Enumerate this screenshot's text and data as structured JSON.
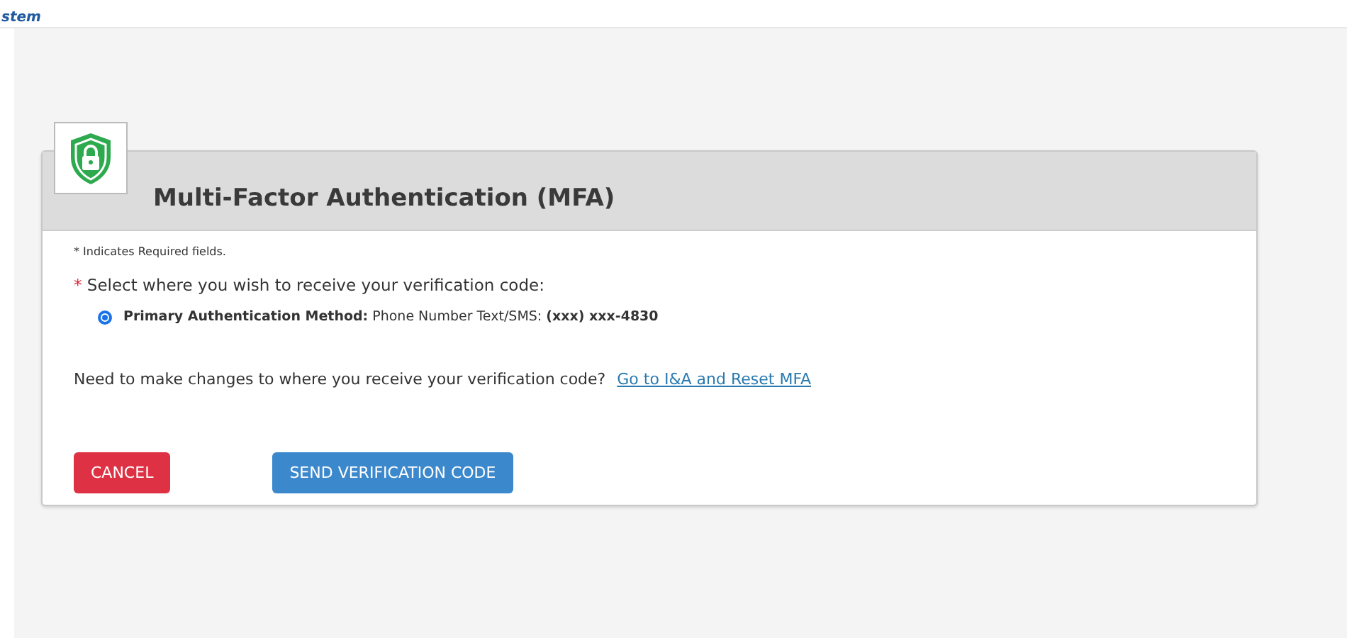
{
  "top_bar": {
    "brand": "stem"
  },
  "card": {
    "title": "Multi-Factor Authentication (MFA)",
    "required_note": "* Indicates Required fields.",
    "question": {
      "required_mark": "*",
      "label": "Select where you wish to receive your verification code:"
    },
    "options": [
      {
        "label": "**Primary Authentication Method:** Phone Number Text/SMS: **(xxx) xxx-4830**",
        "selected": true
      }
    ],
    "change_prompt": "Need to make changes to where you receive your verification code?",
    "change_link": "Go to I&A and Reset MFA",
    "buttons": [
      {
        "label": "CANCEL",
        "kind": "danger"
      },
      {
        "label": "SEND VERIFICATION CODE",
        "kind": "primary"
      }
    ]
  }
}
